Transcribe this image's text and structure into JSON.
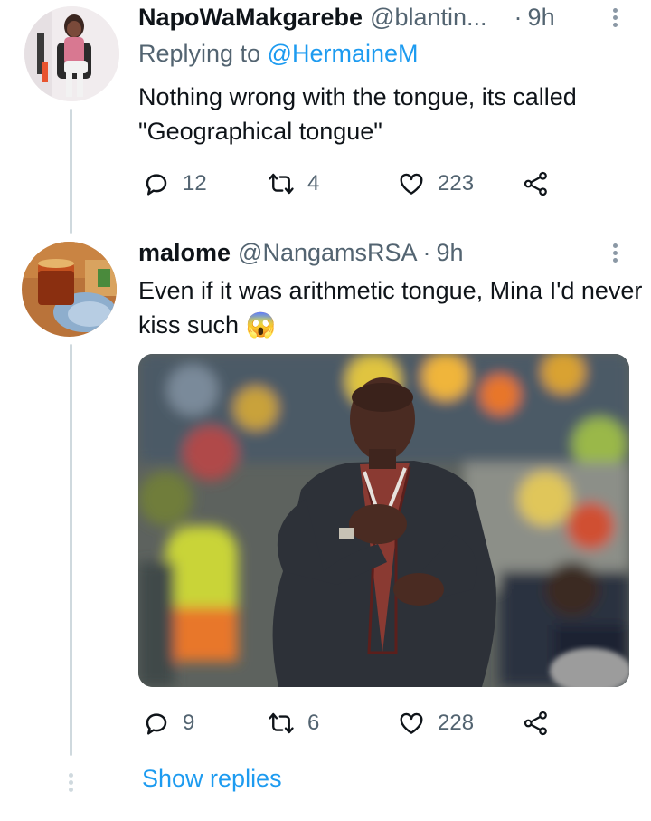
{
  "tweets": [
    {
      "display_name": "NapoWaMakgarebe",
      "handle": "@blantin...",
      "separator": "·",
      "time": "9h",
      "replying_prefix": "Replying to ",
      "replying_to": "@HermaineM",
      "text": "Nothing wrong with the tongue, its called \"Geographical tongue\"",
      "counts": {
        "replies": "12",
        "retweets": "4",
        "likes": "223"
      },
      "icons": [
        "reply-icon",
        "retweet-icon",
        "like-icon",
        "share-icon",
        "more-icon"
      ]
    },
    {
      "display_name": "malome",
      "handle": "@NangamsRSA",
      "separator": "·",
      "time": "9h",
      "text": "Even if it was arithmetic tongue, Mina I'd never kiss such",
      "emoji": "😱",
      "counts": {
        "replies": "9",
        "retweets": "6",
        "likes": "228"
      },
      "icons": [
        "reply-icon",
        "retweet-icon",
        "like-icon",
        "share-icon",
        "more-icon"
      ]
    }
  ],
  "show_replies": "Show replies",
  "colors": {
    "link": "#1d9bf0",
    "secondary": "#536471",
    "thread_line": "#cfd9de",
    "text": "#0f1419"
  }
}
